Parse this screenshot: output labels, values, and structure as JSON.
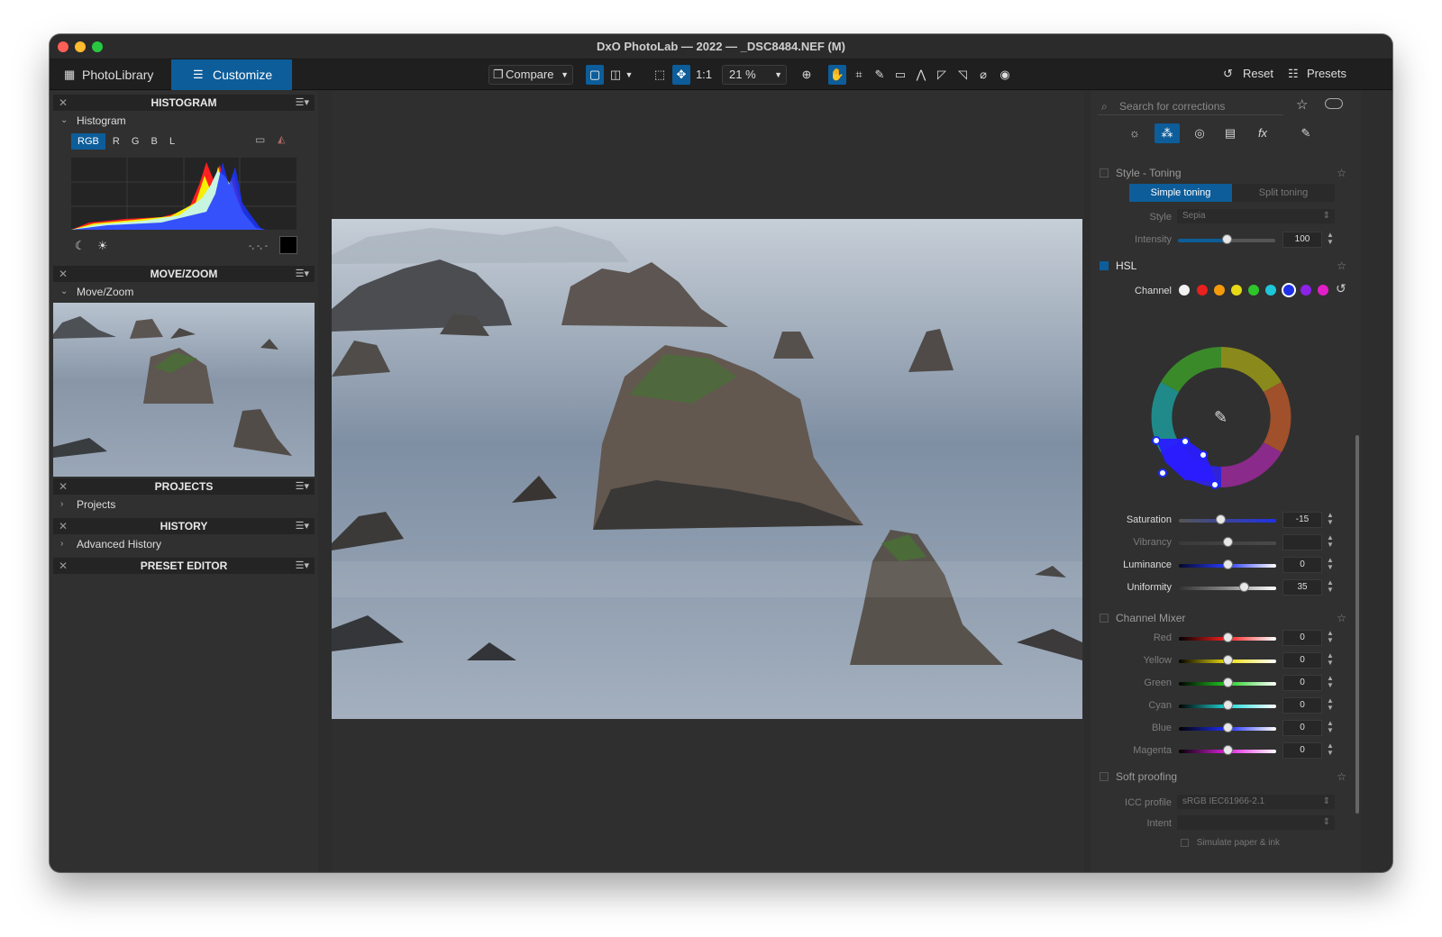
{
  "window": {
    "title": "DxO PhotoLab — 2022 — _DSC8484.NEF (M)"
  },
  "tabs": {
    "library": "PhotoLibrary",
    "customize": "Customize"
  },
  "toolbar": {
    "compare": "Compare",
    "one_to_one": "1:1",
    "zoom": "21 %",
    "reset": "Reset",
    "presets": "Presets"
  },
  "left": {
    "histogram": {
      "title": "HISTOGRAM",
      "sub": "Histogram",
      "channels": [
        "RGB",
        "R",
        "G",
        "B",
        "L"
      ],
      "readout": "-, -, -"
    },
    "movezoom": {
      "title": "MOVE/ZOOM",
      "sub": "Move/Zoom"
    },
    "projects": {
      "title": "PROJECTS",
      "sub": "Projects"
    },
    "history": {
      "title": "HISTORY",
      "sub": "Advanced History"
    },
    "preset_editor": {
      "title": "PRESET EDITOR"
    }
  },
  "right": {
    "search_placeholder": "Search for corrections",
    "style_toning": {
      "title": "Style - Toning",
      "tab_simple": "Simple toning",
      "tab_split": "Split toning",
      "style_label": "Style",
      "style_value": "Sepia",
      "intensity_label": "Intensity",
      "intensity_value": "100",
      "intensity_level": 0.5
    },
    "hsl": {
      "title": "HSL",
      "channel_label": "Channel",
      "sliders": [
        {
          "label": "Saturation",
          "value": "-15",
          "level": 0.43
        },
        {
          "label": "Vibrancy",
          "value": "",
          "level": 0.5
        },
        {
          "label": "Luminance",
          "value": "0",
          "level": 0.5
        },
        {
          "label": "Uniformity",
          "value": "35",
          "level": 0.67
        }
      ]
    },
    "channel_mixer": {
      "title": "Channel Mixer",
      "rows": [
        {
          "label": "Red",
          "value": "0",
          "level": 0.5
        },
        {
          "label": "Yellow",
          "value": "0",
          "level": 0.5
        },
        {
          "label": "Green",
          "value": "0",
          "level": 0.5
        },
        {
          "label": "Cyan",
          "value": "0",
          "level": 0.5
        },
        {
          "label": "Blue",
          "value": "0",
          "level": 0.5
        },
        {
          "label": "Magenta",
          "value": "0",
          "level": 0.5
        }
      ]
    },
    "soft_proofing": {
      "title": "Soft proofing",
      "icc_label": "ICC profile",
      "icc_value": "sRGB IEC61966-2.1",
      "intent_label": "Intent",
      "intent_value": "",
      "simulate": "Simulate paper & ink"
    }
  },
  "colors": {
    "accent": "#0d5d9a",
    "bg": "#2d2d2d",
    "panel": "#303030"
  }
}
